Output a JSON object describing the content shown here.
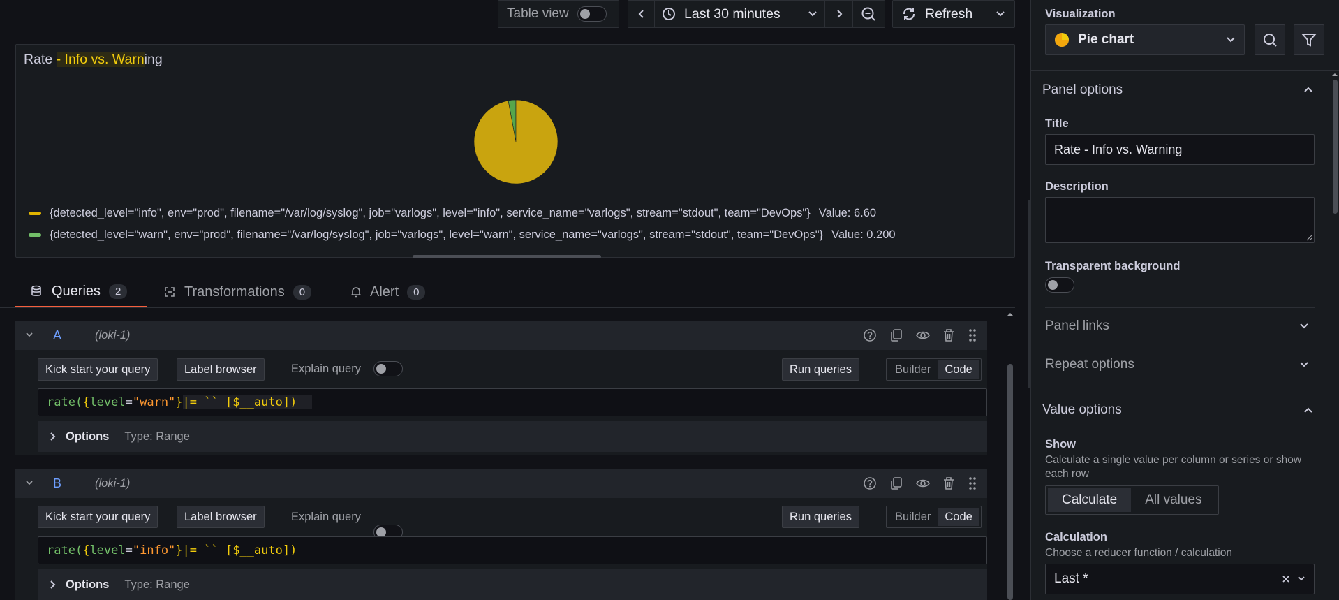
{
  "toolbar": {
    "table_view_label": "Table view",
    "time_range_label": "Last 30 minutes",
    "refresh_label": "Refresh"
  },
  "panel": {
    "title_prefix": "Rate ",
    "title_highlight": "- Info vs. Warn",
    "title_suffix": "ing",
    "legend": [
      {
        "text": "{detected_level=\"info\", env=\"prod\", filename=\"/var/log/syslog\", job=\"varlogs\", level=\"info\", service_name=\"varlogs\", stream=\"stdout\", team=\"DevOps\"}",
        "value_text": "Value: 6.60",
        "color": "#d6b31c"
      },
      {
        "text": "{detected_level=\"warn\", env=\"prod\", filename=\"/var/log/syslog\", job=\"varlogs\", level=\"warn\", service_name=\"varlogs\", stream=\"stdout\", team=\"DevOps\"}",
        "value_text": "Value: 0.200",
        "color": "#56a64b"
      }
    ]
  },
  "chart_data": {
    "type": "pie",
    "series": [
      {
        "name": "{detected_level=\"info\", env=\"prod\", filename=\"/var/log/syslog\", job=\"varlogs\", level=\"info\", service_name=\"varlogs\", stream=\"stdout\", team=\"DevOps\"}",
        "value": 6.6,
        "color": "#c9a40f"
      },
      {
        "name": "{detected_level=\"warn\", env=\"prod\", filename=\"/var/log/syslog\", job=\"varlogs\", level=\"warn\", service_name=\"varlogs\", stream=\"stdout\", team=\"DevOps\"}",
        "value": 0.2,
        "color": "#56a64b"
      }
    ]
  },
  "tabs": [
    {
      "label": "Queries",
      "count": "2"
    },
    {
      "label": "Transformations",
      "count": "0"
    },
    {
      "label": "Alert",
      "count": "0"
    }
  ],
  "queries": [
    {
      "ref": "A",
      "datasource": "(loki-1)",
      "kick_start": "Kick start your query",
      "label_browser": "Label browser",
      "explain": "Explain query",
      "run": "Run queries",
      "builder": "Builder",
      "code": "Code",
      "expr": {
        "fn": "rate(",
        "brace_open": "{",
        "key": "level",
        "eq": "=",
        "val": "\"warn\"",
        "brace_close": "}",
        "rest": " |= `` [$__auto])"
      },
      "options_label": "Options",
      "type_label": "Type: Range"
    },
    {
      "ref": "B",
      "datasource": "(loki-1)",
      "kick_start": "Kick start your query",
      "label_browser": "Label browser",
      "explain": "Explain query",
      "run": "Run queries",
      "builder": "Builder",
      "code": "Code",
      "expr": {
        "fn": "rate(",
        "brace_open": "{",
        "key": "level",
        "eq": "=",
        "val": "\"info\"",
        "brace_close": "}",
        "rest": " |= `` [$__auto])"
      },
      "options_label": "Options",
      "type_label": "Type: Range"
    }
  ],
  "sidebar": {
    "visualization_label": "Visualization",
    "visualization_value": "Pie chart",
    "panel_options": "Panel options",
    "title_label": "Title",
    "title_value": "Rate - Info vs. Warning",
    "description_label": "Description",
    "description_value": "",
    "transparent_label": "Transparent background",
    "panel_links": "Panel links",
    "repeat_options": "Repeat options",
    "value_options": "Value options",
    "show_label": "Show",
    "show_desc": "Calculate a single value per column or series or show each row",
    "calculate": "Calculate",
    "all_values": "All values",
    "calculation_label": "Calculation",
    "calculation_desc": "Choose a reducer function / calculation",
    "calculation_value": "Last *"
  }
}
